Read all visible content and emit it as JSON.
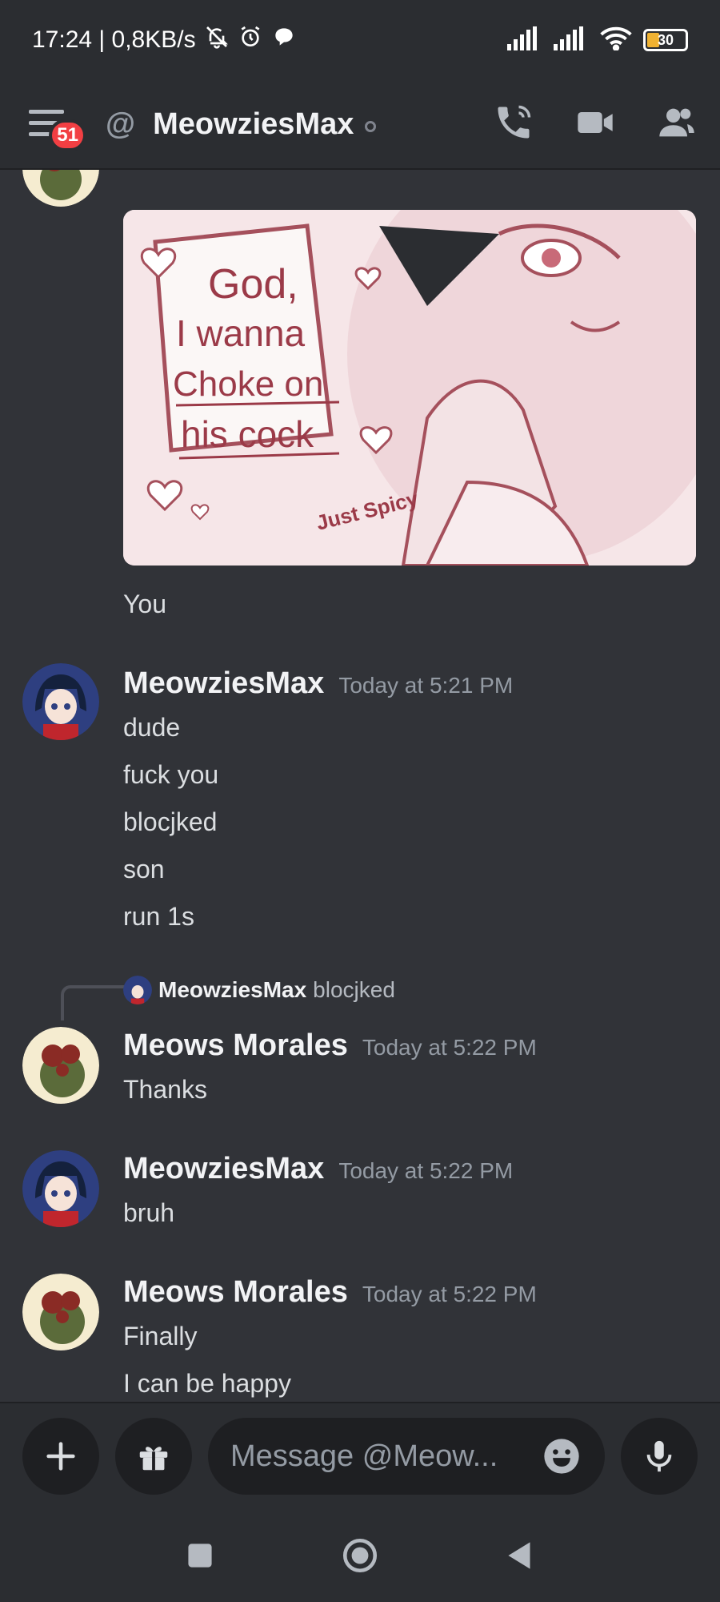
{
  "status_bar": {
    "time_speed": "17:24 | 0,8KB/s",
    "battery": "30"
  },
  "header": {
    "unread_count": "51",
    "at": "@",
    "dm_name": "MeowziesMax"
  },
  "chat": {
    "image_caption_lines": [
      "God,",
      "I wanna",
      "Choke on",
      "his cock"
    ],
    "image_signature": "Just Spicy",
    "after_image_text": "You",
    "messages": [
      {
        "author": "MeowziesMax",
        "time": "Today at 5:21 PM",
        "lines": [
          "dude",
          "fuck you",
          "blocjked",
          "son",
          "run 1s"
        ]
      },
      {
        "reply_to_author": "MeowziesMax",
        "reply_to_text": "blocjked",
        "author": "Meows Morales",
        "time": "Today at 5:22 PM",
        "lines": [
          "Thanks"
        ]
      },
      {
        "author": "MeowziesMax",
        "time": "Today at 5:22 PM",
        "lines": [
          "bruh"
        ]
      },
      {
        "author": "Meows Morales",
        "time": "Today at 5:22 PM",
        "lines": [
          "Finally",
          "I can be happy"
        ]
      }
    ]
  },
  "composer": {
    "placeholder": "Message @Meow..."
  },
  "colors": {
    "background": "#313338",
    "chrome": "#2b2d31",
    "input": "#1e1f22",
    "badge": "#f23f43",
    "battery": "#f0b232"
  },
  "icons": [
    "bell-off-icon",
    "alarm-icon",
    "chat-bubble-icon",
    "signal-icon",
    "wifi-icon",
    "battery-icon",
    "menu-icon",
    "phone-icon",
    "video-icon",
    "members-icon",
    "plus-icon",
    "gift-icon",
    "emoji-icon",
    "mic-icon",
    "nav-recents-icon",
    "nav-home-icon",
    "nav-back-icon"
  ]
}
